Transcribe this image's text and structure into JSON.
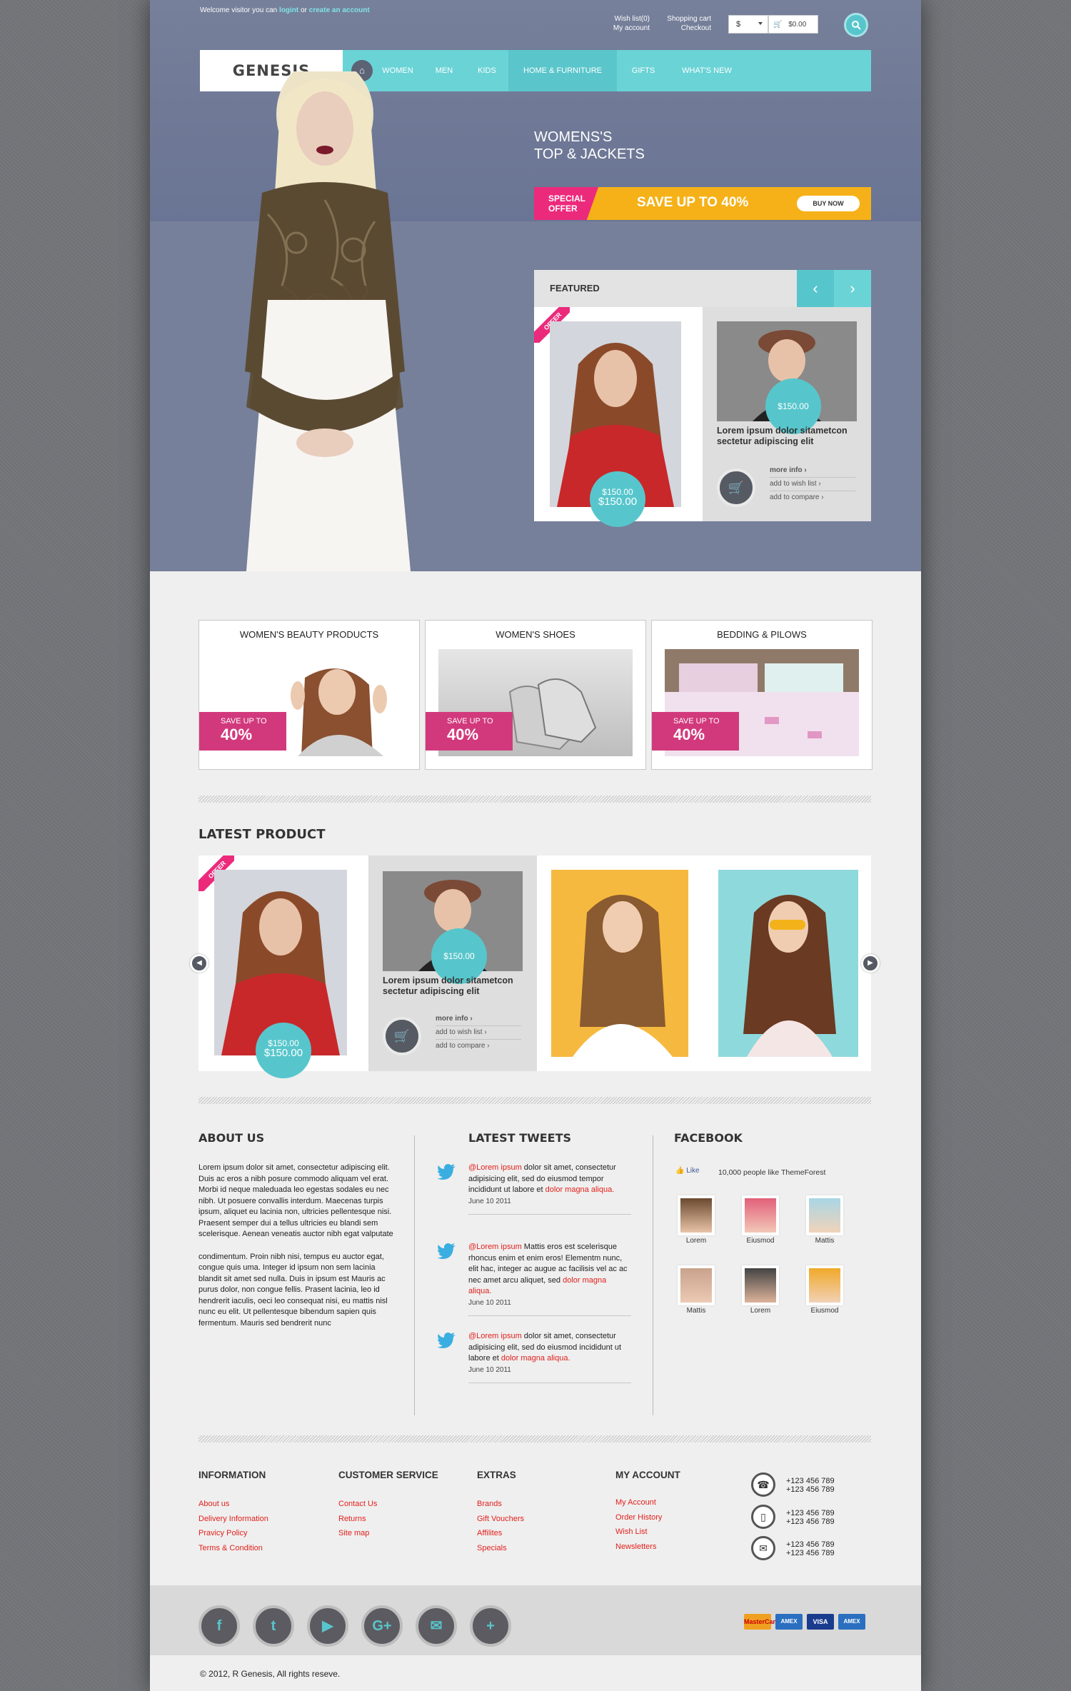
{
  "topbar": {
    "welcome_prefix": "Welcome visitor you can",
    "login": "logint",
    "or": "or",
    "create": "create an account",
    "wishlist": "Wish list(0)",
    "my_account": "My account",
    "shopping_cart": "Shopping cart",
    "checkout": "Checkout",
    "currency": "$",
    "cart_total": "$0.00"
  },
  "logo": "GENESIS",
  "nav": {
    "items": [
      "WOMEN",
      "MEN",
      "KIDS",
      "HOME & FURNITURE",
      "GIFTS",
      "WHAT'S NEW"
    ],
    "active": "HOME & FURNITURE"
  },
  "hero": {
    "title_line1": "WOMENS'S",
    "title_line2": "TOP & JACKETS",
    "offer_line1": "SPECIAL",
    "offer_line2": "OFFER",
    "save_text": "SAVE UP TO 40%",
    "buy_now": "BUY NOW"
  },
  "featured": {
    "title": "FEATURED",
    "offer_tag": "OFFER",
    "item1_price_small": "$150.00",
    "item1_price_big": "$150.00",
    "item2_price": "$150.00",
    "item2_desc": "Lorem ipsum dolor sitametcon sectetur adipiscing elit",
    "more_info": "more info ›",
    "add_wish": "add to wish list ›",
    "add_compare": "add to compare ›"
  },
  "categories": [
    {
      "title": "WOMEN'S BEAUTY PRODUCTS",
      "save": "SAVE UP TO",
      "percent": "40%"
    },
    {
      "title": "WOMEN'S SHOES",
      "save": "SAVE UP TO",
      "percent": "40%"
    },
    {
      "title": "BEDDING & PILOWS",
      "save": "SAVE UP TO",
      "percent": "40%"
    }
  ],
  "latest": {
    "title": "LATEST PRODUCT",
    "offer_tag": "OFFER",
    "item1_price_small": "$150.00",
    "item1_price_big": "$150.00",
    "item2_price": "$150.00",
    "item2_desc": "Lorem ipsum dolor sitametcon sectetur adipiscing elit",
    "more_info": "more info ›",
    "add_wish": "add to wish list ›",
    "add_compare": "add to compare ›"
  },
  "about": {
    "title": "ABOUT US",
    "p1": "Lorem ipsum dolor sit amet, consectetur adipiscing elit. Duis ac eros a nibh posure commodo aliquam vel erat. Morbi id neque maleduada leo egestas sodales eu nec nibh. Ut posuere convallis interdum. Maecenas turpis ipsum, aliquet eu lacinia non, ultricies pellentesque nisi. Praesent semper dui a tellus ultricies eu blandi sem scelerisque. Aenean veneatis auctor nibh egat valputate",
    "p2": "condimentum. Proin nibh nisi, tempus eu auctor egat, congue quis uma. Integer id ipsum non sem lacinia blandit sit amet sed nulla. Duis in ipsum est Mauris ac purus dolor, non congue fellis. Prasent lacinia, leo id hendrerit iaculis, oeci leo consequat nisi, eu mattis nisl nunc eu elit. Ut pellentesque bibendum sapien quis fermentum. Mauris sed bendrerit nunc"
  },
  "tweets": {
    "title": "LATEST TWEETS",
    "items": [
      {
        "handle": "@Lorem ipsum",
        "text": " dolor sit amet, consectetur adipisicing elit, sed do eiusmod tempor incididunt ut labore et ",
        "link": "dolor magna aliqua.",
        "date": "June 10 2011"
      },
      {
        "handle": "@Lorem ipsum",
        "text": " Mattis eros est scelerisque rhoncus enim et enim eros! Elementm nunc, elit hac, integer ac augue ac facilisis vel ac ac nec amet arcu aliquet, sed ",
        "link": "dolor magna aliqua.",
        "date": "June 10 2011"
      },
      {
        "handle": "@Lorem ipsum",
        "text": " dolor sit amet, consectetur adipisicing elit, sed do eiusmod incididunt ut labore et ",
        "link": "dolor magna aliqua.",
        "date": "June 10 2011"
      }
    ]
  },
  "facebook": {
    "title": "FACEBOOK",
    "like": "Like",
    "count": "10,000 people like ThemeForest",
    "people": [
      "Lorem",
      "Eiusmod",
      "Mattis",
      "Mattis",
      "Lorem",
      "Eiusmod"
    ]
  },
  "footer": {
    "information": {
      "title": "INFORMATION",
      "links": [
        "About us",
        "Delivery Information",
        "Pravicy Policy",
        "Terms & Condition"
      ]
    },
    "customer_service": {
      "title": "CUSTOMER SERVICE",
      "links": [
        "Contact Us",
        "Returns",
        "Site map"
      ]
    },
    "extras": {
      "title": "EXTRAS",
      "links": [
        "Brands",
        "Gift Vouchers",
        "Affilites",
        "Specials"
      ]
    },
    "my_account": {
      "title": "MY ACCOUNT",
      "links": [
        "My Account",
        "Order History",
        "Wish List",
        "Newsletters"
      ]
    },
    "phone1": "+123 456 789",
    "phone2": "+123 456 789",
    "mobile1": "+123 456 789",
    "mobile2": "+123 456 789",
    "mail1": "+123 456 789",
    "mail2": "+123 456 789"
  },
  "social": [
    "facebook-icon",
    "twitter-icon",
    "youtube-icon",
    "google-plus-icon",
    "email-icon",
    "plus-icon"
  ],
  "payments": [
    "MasterCard",
    "AMEX",
    "VISA",
    "AMEX"
  ],
  "copyright": "© 2012, R Genesis, All rights reseve."
}
